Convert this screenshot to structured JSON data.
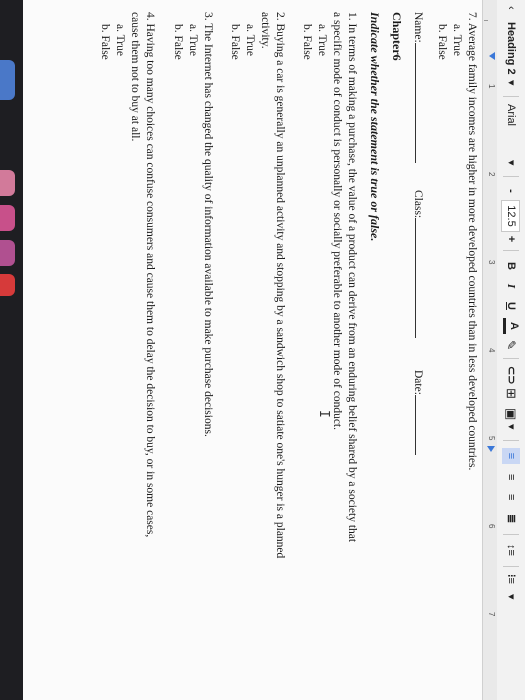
{
  "toolbar": {
    "style": "Heading 2",
    "font": "Arial",
    "size": "12.5",
    "minus": "-",
    "plus": "+",
    "bold": "B",
    "italic": "I",
    "underline": "U",
    "text_color": "A",
    "highlight_icon": "highlighter-icon",
    "link_icon": "link-icon",
    "image_icon": "image-icon",
    "comment_icon": "comment-icon",
    "align_icons": [
      "align-left-icon",
      "align-center-icon",
      "align-right-icon",
      "justify-icon"
    ],
    "spacing_icon": "line-spacing-icon",
    "list_icon": "bullet-list-icon",
    "dropdown_icon": "chevron-down-icon"
  },
  "ruler": {
    "numbers": [
      "1",
      "2",
      "3",
      "4",
      "5",
      "6",
      "7"
    ]
  },
  "document": {
    "q7": "7. Average family incomes are higher in more developed countries than in less developed countries.",
    "q7_a": "a. True",
    "q7_b": "b. False",
    "name_label": "Name:",
    "class_label": "Class:",
    "date_label": "Date:",
    "chapter": "Chapter6",
    "instruction": "Indicate whether the statement is true or false.",
    "q1_line1": "1.      In terms of making a purchase, the value of a product can derive from an enduring belief shared by a society that",
    "q1_line2": "a specific mode of conduct is personally or socially preferable to another mode of conduct.",
    "q1_a": "a. True",
    "q1_b": "b. False",
    "q2_line1": "2.      Buying a car is generally an unplanned activity and stopping by a sandwich shop to satiate one's hunger is a planned",
    "q2_line2": "activity.",
    "q2_a": "a. True",
    "q2_b": "b. False",
    "q3": "3. The Internet has changed the quality of information available to make purchase decisions.",
    "q3_a": "a. True",
    "q3_b": "b. False",
    "q4_line1": "4.      Having too many choices can confuse consumers and cause them to delay the decision to buy, or in some cases,",
    "q4_line2": "cause them not to buy at all.",
    "q4_a": "a. True",
    "q4_b": "b. False",
    "cursor_glyph": "I"
  },
  "colors": {
    "page": "#fbfbfb",
    "toolbar": "#f2f2f2",
    "accent": "#3b78d8",
    "text_red": "#d93025",
    "desk": "#1e1e22"
  }
}
